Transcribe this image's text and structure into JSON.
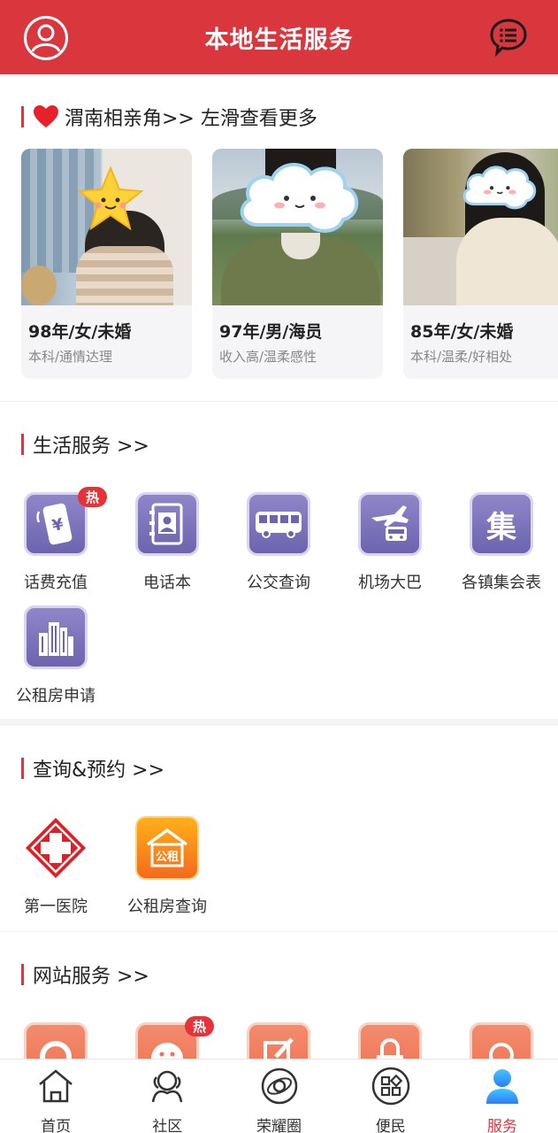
{
  "header": {
    "title": "本地生活服务",
    "avatar_icon": "user-icon",
    "message_icon": "chat-list-icon"
  },
  "dating": {
    "heading": "渭南相亲角>> 左滑查看更多",
    "cards": [
      {
        "line1": "98年/女/未婚",
        "line2": "本科/通情达理"
      },
      {
        "line1": "97年/男/海员",
        "line2": "收入高/温柔感性"
      },
      {
        "line1": "85年/女/未婚",
        "line2": "本科/温柔/好相处"
      }
    ]
  },
  "life": {
    "heading": "生活服务 >>",
    "items": [
      {
        "label": "话费充值",
        "hot": "热"
      },
      {
        "label": "电话本"
      },
      {
        "label": "公交查询"
      },
      {
        "label": "机场大巴"
      },
      {
        "label": "各镇集会表",
        "glyph": "集"
      },
      {
        "label": "公租房申请"
      }
    ]
  },
  "query": {
    "heading": "查询&预约 >>",
    "items": [
      {
        "label": "第一医院"
      },
      {
        "label": "公租房查询",
        "glyph": "公租"
      }
    ]
  },
  "web": {
    "heading": "网站服务 >>",
    "hot": "热"
  },
  "nav": [
    {
      "label": "首页"
    },
    {
      "label": "社区"
    },
    {
      "label": "荣耀圈"
    },
    {
      "label": "便民"
    },
    {
      "label": "服务"
    }
  ],
  "colors": {
    "brand": "#d9363e",
    "purple": "#7a72b9",
    "salmon": "#f07e60"
  }
}
